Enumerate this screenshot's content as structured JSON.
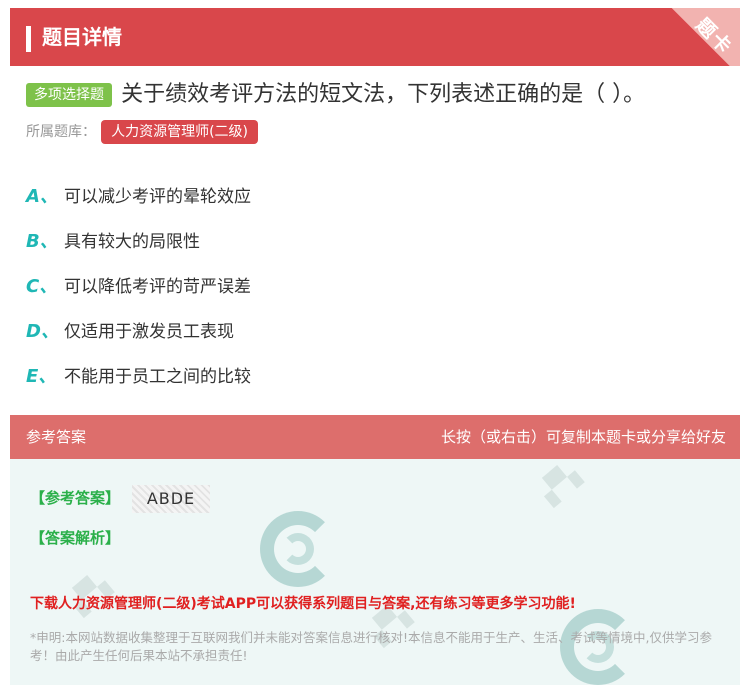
{
  "header": {
    "title": "题目详情",
    "corner_label": "题卡"
  },
  "question": {
    "type_badge": "多项选择题",
    "text": "关于绩效考评方法的短文法，下列表述正确的是（ ）。",
    "bank_label": "所属题库：",
    "bank_name": "人力资源管理师(二级)"
  },
  "options": [
    {
      "letter": "A、",
      "text": "可以减少考评的晕轮效应"
    },
    {
      "letter": "B、",
      "text": "具有较大的局限性"
    },
    {
      "letter": "C、",
      "text": "可以降低考评的苛严误差"
    },
    {
      "letter": "D、",
      "text": "仅适用于激发员工表现"
    },
    {
      "letter": "E、",
      "text": "不能用于员工之间的比较"
    }
  ],
  "answer": {
    "section_label": "参考答案",
    "hint": "长按（或右击）可复制本题卡或分享给好友",
    "key_label": "【参考答案】",
    "key_value": "ABDE",
    "explain_label": "【答案解析】",
    "promo": "下载人力资源管理师(二级)考试APP可以获得系列题目与答案,还有练习等更多学习功能!",
    "disclaimer": "*申明:本网站数据收集整理于互联网我们并未能对答案信息进行核对!本信息不能用于生产、生活、考试等情境中,仅供学习参考！由此产生任何后果本站不承担责任!"
  },
  "colors": {
    "header_bg": "#d9474b",
    "answer_header_bg": "#dd6e6c",
    "answer_body_bg": "#eef7f6",
    "option_letter": "#1fb7b5",
    "badge_green": "#7ec24a",
    "answer_green": "#2bb04a",
    "promo_red": "#e02020"
  }
}
